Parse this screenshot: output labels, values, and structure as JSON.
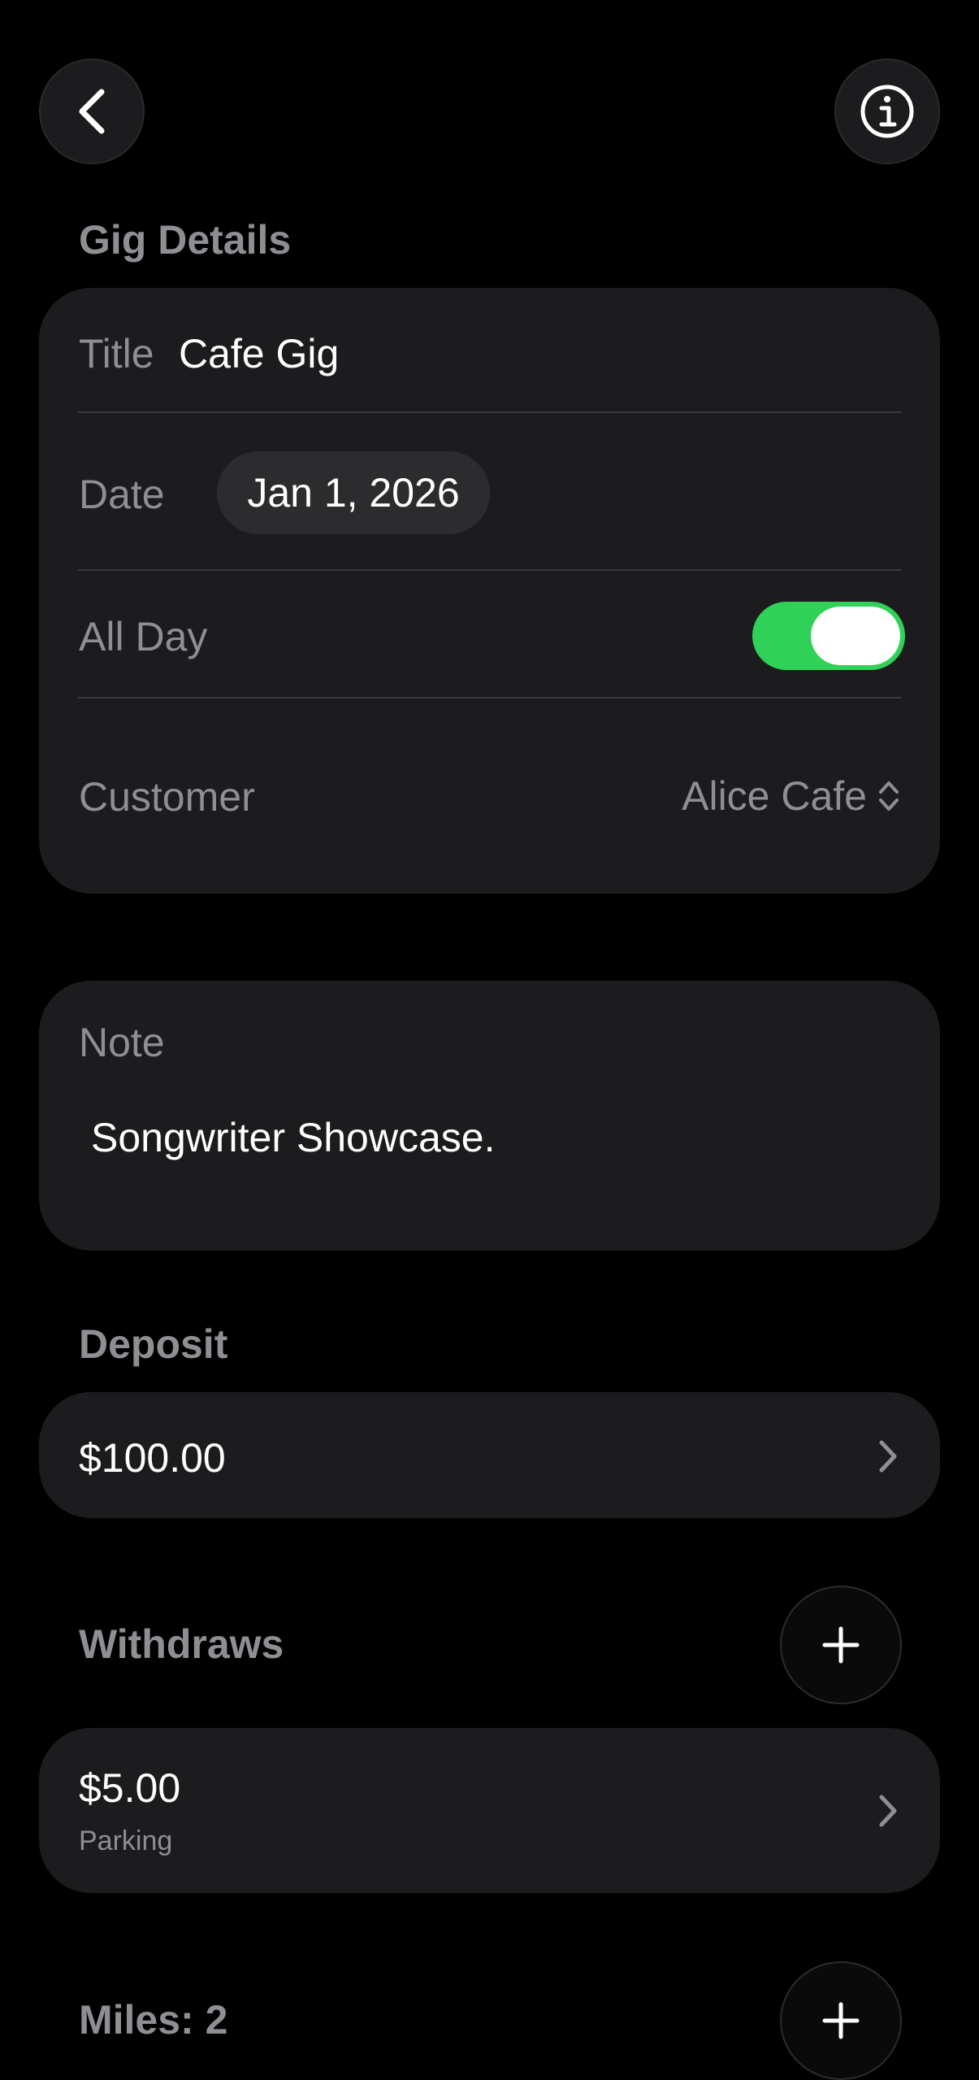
{
  "header": {
    "back_icon": "chevron-left-icon",
    "info_icon": "info-circle-icon"
  },
  "gig_details": {
    "section_title": "Gig Details",
    "title_label": "Title",
    "title_value": "Cafe Gig",
    "date_label": "Date",
    "date_value": "Jan 1, 2026",
    "all_day_label": "All Day",
    "all_day_on": true,
    "customer_label": "Customer",
    "customer_value": "Alice Cafe"
  },
  "note": {
    "label": "Note",
    "text": "Songwriter Showcase."
  },
  "deposit": {
    "section_title": "Deposit",
    "amount": "$100.00"
  },
  "withdraws": {
    "section_title": "Withdraws",
    "items": [
      {
        "amount": "$5.00",
        "description": "Parking"
      }
    ]
  },
  "miles": {
    "section_title": "Miles: 2"
  },
  "colors": {
    "background": "#000000",
    "card": "#1c1c1e",
    "toggle_on": "#30d158",
    "secondary_text": "#8e8e93"
  }
}
